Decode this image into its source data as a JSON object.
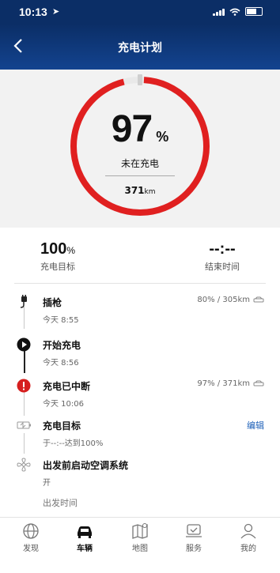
{
  "status_bar": {
    "time": "10:13"
  },
  "header": {
    "title": "充电计划"
  },
  "gauge": {
    "percent": "97",
    "percent_unit": "%",
    "level": 0.97,
    "status": "未在充电",
    "range_value": "371",
    "range_unit": "km"
  },
  "stats": {
    "target_value": "100",
    "target_unit": "%",
    "target_label": "充电目标",
    "end_value": "--:--",
    "end_label": "结束时间"
  },
  "timeline": [
    {
      "name": "插枪",
      "sub": "今天 8:55",
      "right": "80% / 305km"
    },
    {
      "name": "开始充电",
      "sub": "今天 8:56"
    },
    {
      "name": "充电已中断",
      "sub": "今天 10:06",
      "right": "97% / 371km"
    },
    {
      "name": "充电目标",
      "sub": "于--:--达到100%",
      "link": "编辑"
    },
    {
      "name": "出发前启动空调系统",
      "sub": "开"
    },
    {
      "name": "出发时间"
    }
  ],
  "tabs": [
    {
      "label": "发现",
      "icon": "globe-icon"
    },
    {
      "label": "车辆",
      "icon": "car-icon"
    },
    {
      "label": "地图",
      "icon": "map-icon"
    },
    {
      "label": "服务",
      "icon": "service-icon"
    },
    {
      "label": "我的",
      "icon": "profile-icon"
    }
  ],
  "colors": {
    "accent": "#e02020",
    "header": "#0b2e66",
    "link": "#1c5fb8"
  }
}
